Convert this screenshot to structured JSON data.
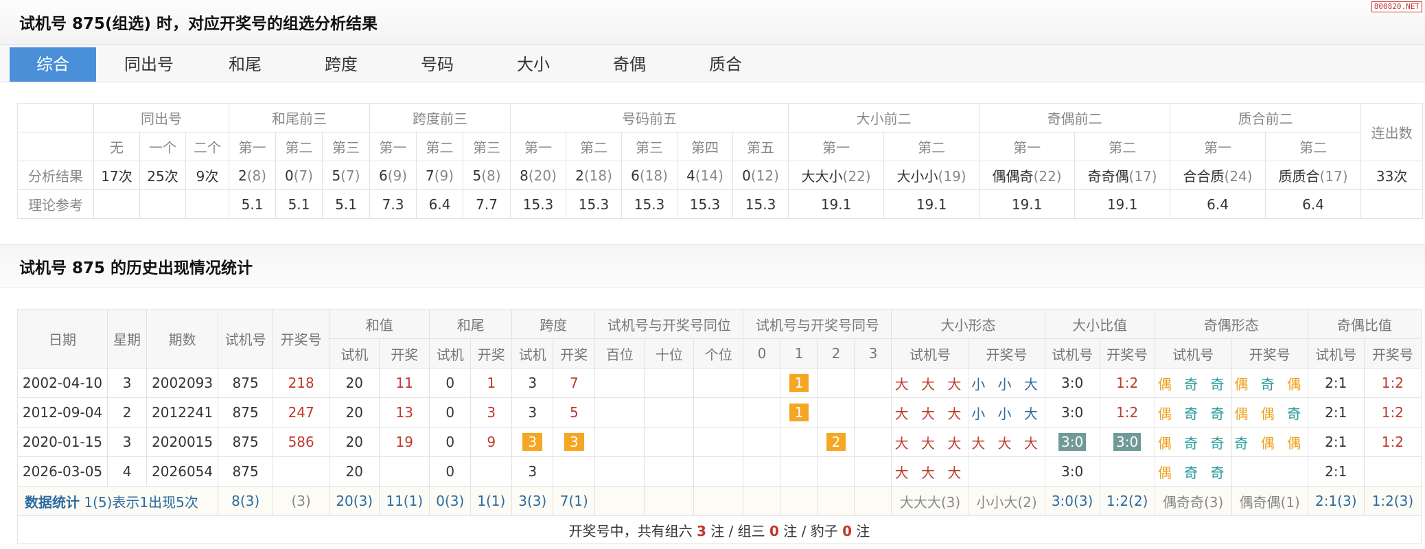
{
  "watermark": "800820.NET",
  "title1": "试机号 875(组选) 时，对应开奖号的组选分析结果",
  "tabs": [
    "综合",
    "同出号",
    "和尾",
    "跨度",
    "号码",
    "大小",
    "奇偶",
    "质合"
  ],
  "t1": {
    "groups": [
      "同出号",
      "和尾前三",
      "跨度前三",
      "号码前五",
      "大小前二",
      "奇偶前二",
      "质合前二",
      "连出数"
    ],
    "sub": [
      "无",
      "一个",
      "二个",
      "第一",
      "第二",
      "第三",
      "第一",
      "第二",
      "第三",
      "第一",
      "第二",
      "第三",
      "第四",
      "第五",
      "第一",
      "第二",
      "第一",
      "第二",
      "第一",
      "第二"
    ],
    "row1_label": "分析结果",
    "row1": {
      "a": "17次",
      "b": "25次",
      "c": "9次",
      "h1": "2",
      "h1c": "(8)",
      "h2": "0",
      "h2c": "(7)",
      "h3": "5",
      "h3c": "(7)",
      "k1": "6",
      "k1c": "(9)",
      "k2": "7",
      "k2c": "(9)",
      "k3": "5",
      "k3c": "(8)",
      "n1": "8",
      "n1c": "(20)",
      "n2": "2",
      "n2c": "(18)",
      "n3": "6",
      "n3c": "(18)",
      "n4": "4",
      "n4c": "(14)",
      "n5": "0",
      "n5c": "(12)",
      "d1": "大大小",
      "d1c": "(22)",
      "d2": "大小小",
      "d2c": "(19)",
      "j1": "偶偶奇",
      "j1c": "(22)",
      "j2": "奇奇偶",
      "j2c": "(17)",
      "z1": "合合质",
      "z1c": "(24)",
      "z2": "质质合",
      "z2c": "(17)",
      "lian": "33次"
    },
    "row2_label": "理论参考",
    "row2": [
      "5.1",
      "5.1",
      "5.1",
      "7.3",
      "6.4",
      "7.7",
      "15.3",
      "15.3",
      "15.3",
      "15.3",
      "15.3",
      "19.1",
      "19.1",
      "19.1",
      "19.1",
      "6.4",
      "6.4"
    ]
  },
  "title2": "试机号 875 的历史出现情况统计",
  "t2": {
    "h": {
      "date": "日期",
      "week": "星期",
      "issue": "期数",
      "sj": "试机号",
      "kj": "开奖号",
      "hz": "和值",
      "hw": "和尾",
      "kd": "跨度",
      "tw": "试机号与开奖号同位",
      "th": "试机号与开奖号同号",
      "dx": "大小形态",
      "dxb": "大小比值",
      "jo": "奇偶形态",
      "job": "奇偶比值",
      "s": "试机",
      "k": "开奖",
      "bai": "百位",
      "shi": "十位",
      "ge": "个位",
      "n0": "0",
      "n1": "1",
      "n2": "2",
      "n3": "3",
      "sjh": "试机号",
      "kjh": "开奖号"
    },
    "rows": [
      {
        "date": "2002-04-10",
        "week": "3",
        "issue": "2002093",
        "sj": "875",
        "kj": "218",
        "hzs": "20",
        "hzk": "11",
        "hws": "0",
        "hwk": "1",
        "kds": "3",
        "kdk": "7",
        "th1": "1",
        "th2": "",
        "dxs": "大 大 大",
        "dxk": "小 小 大",
        "dxbs": "3:0",
        "dxbk": "1:2",
        "jos": "偶 奇 奇",
        "jok": "偶 奇 偶",
        "jobs": "2:1",
        "jobk": "1:2"
      },
      {
        "date": "2012-09-04",
        "week": "2",
        "issue": "2012241",
        "sj": "875",
        "kj": "247",
        "hzs": "20",
        "hzk": "13",
        "hws": "0",
        "hwk": "3",
        "kds": "3",
        "kdk": "5",
        "th1": "1",
        "th2": "",
        "dxs": "大 大 大",
        "dxk": "小 小 大",
        "dxbs": "3:0",
        "dxbk": "1:2",
        "jos": "偶 奇 奇",
        "jok": "偶 偶 奇",
        "jobs": "2:1",
        "jobk": "1:2"
      },
      {
        "date": "2020-01-15",
        "week": "3",
        "issue": "2020015",
        "sj": "875",
        "kj": "586",
        "hzs": "20",
        "hzk": "19",
        "hws": "0",
        "hwk": "9",
        "kds": "3",
        "kdk": "3",
        "th1": "",
        "th2": "2",
        "dxs": "大 大 大",
        "dxk": "大 大 大",
        "dxbs": "3:0",
        "dxbk": "3:0",
        "jos": "偶 奇 奇",
        "jok": "奇 偶 偶",
        "jobs": "2:1",
        "jobk": "1:2"
      },
      {
        "date": "2026-03-05",
        "week": "4",
        "issue": "2026054",
        "sj": "875",
        "kj": "",
        "hzs": "20",
        "hzk": "",
        "hws": "0",
        "hwk": "",
        "kds": "3",
        "kdk": "",
        "th1": "",
        "th2": "",
        "dxs": "大 大 大",
        "dxk": "",
        "dxbs": "3:0",
        "dxbk": "",
        "jos": "偶 奇 奇",
        "jok": "",
        "jobs": "2:1",
        "jobk": ""
      }
    ],
    "sum": {
      "label": "数据统计",
      "note": "1(5)表示1出现5次",
      "sj": "8(3)",
      "kj": "(3)",
      "hzs": "20(3)",
      "hzk": "11(1)",
      "hws": "0(3)",
      "hwk": "1(1)",
      "kds": "3(3)",
      "kdk": "7(1)",
      "dxs": "大大大(3)",
      "dxk": "小小大(2)",
      "dxbs": "3:0(3)",
      "dxbk": "1:2(2)",
      "jos": "偶奇奇(3)",
      "jok": "偶奇偶(1)",
      "jobs": "2:1(3)",
      "jobk": "1:2(3)"
    },
    "foot": {
      "a": "开奖号中，共有组六 ",
      "n1": "3",
      "b": " 注 / 组三 ",
      "n2": "0",
      "c": " 注 / 豹子 ",
      "n3": "0",
      "d": " 注"
    }
  }
}
